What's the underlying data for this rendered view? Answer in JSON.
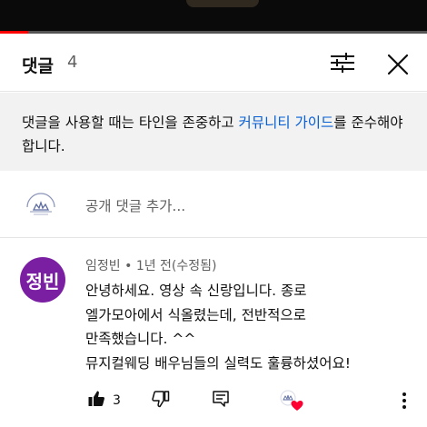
{
  "video": {
    "progress_fraction": 0.065
  },
  "header": {
    "title": "댓글",
    "count": "4",
    "filter_icon": "sort-filter-icon",
    "close_icon": "close-icon"
  },
  "notice": {
    "text_before": "댓글을 사용할 때는 타인을 존중하고 ",
    "link_text": "커뮤니티 가이드",
    "text_after": "를 준수해야 합니다."
  },
  "add_comment": {
    "channel_logo": "channel-logo",
    "placeholder": "공개 댓글 추가..."
  },
  "comment": {
    "avatar_text": "정빈",
    "avatar_color": "#7b1fa2",
    "author": "임정빈",
    "separator": "•",
    "time": "1년 전(수정됨)",
    "lines": [
      "안녕하세요. 영상 속 신랑입니다. 종로",
      "엘가모아에서 식올렸는데, 전반적으로",
      "만족했습니다. ^^",
      "뮤지컬웨딩 배우님들의 실력도 훌륭하셨어요!"
    ],
    "like_count": "3",
    "heart_color": "#ff0033"
  }
}
